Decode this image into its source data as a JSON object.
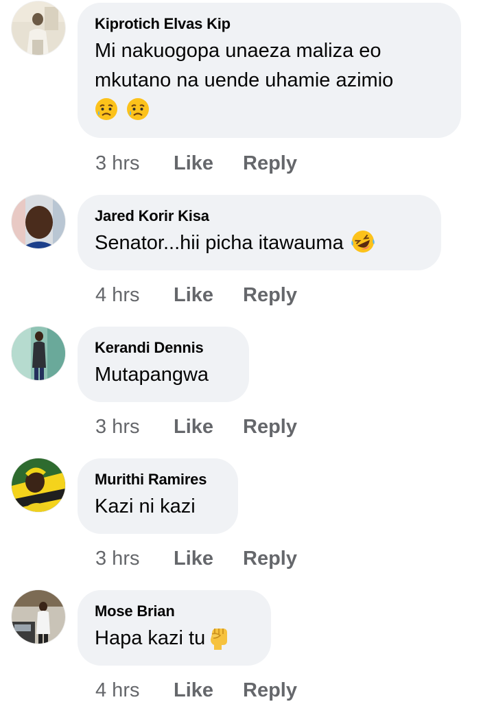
{
  "comments": [
    {
      "author": "Kiprotich Elvas Kip",
      "text_line1": "Mi nakuogopa unaeza maliza eo",
      "text_line2": "mkutano na uende uhamie azimio",
      "emojis": [
        "sad-but-relieved-face",
        "sad-but-relieved-face"
      ],
      "time": "3 hrs",
      "like_label": "Like",
      "reply_label": "Reply"
    },
    {
      "author": "Jared Korir Kisa",
      "text": "Senator...hii picha itawauma",
      "emojis": [
        "rolling-on-the-floor-laughing"
      ],
      "time": "4 hrs",
      "like_label": "Like",
      "reply_label": "Reply"
    },
    {
      "author": "Kerandi Dennis",
      "text": "Mutapangwa",
      "time": "3 hrs",
      "like_label": "Like",
      "reply_label": "Reply"
    },
    {
      "author": "Murithi Ramires",
      "text": "Kazi ni kazi",
      "time": "3 hrs",
      "like_label": "Like",
      "reply_label": "Reply"
    },
    {
      "author": "Mose Brian",
      "text": "Hapa kazi tu",
      "emojis": [
        "raised-fist"
      ],
      "time": "4 hrs",
      "like_label": "Like",
      "reply_label": "Reply"
    }
  ],
  "colors": {
    "bubble": "#f0f2f5",
    "text": "#050505",
    "meta": "#65676b"
  }
}
